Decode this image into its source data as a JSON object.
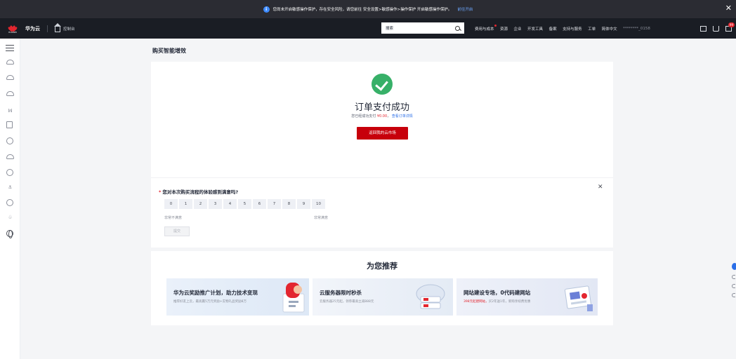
{
  "notice": {
    "text": "您尚未开启敏感操作保护，存在安全风险，请您前往 安全设置>敏感操作>操作保护 开启敏感操作保护。",
    "link": "前往开启"
  },
  "topnav": {
    "brand": "华为云",
    "logo_sub": "HUAWEI",
    "console": "控制台",
    "search_placeholder": "搜索",
    "links": [
      "费用与成本",
      "资源",
      "企业",
      "开发工具",
      "备案",
      "支持与服务",
      "工单",
      "简体中文"
    ],
    "username": "********_0158",
    "message_badge": "99"
  },
  "page": {
    "title": "购买智能增效"
  },
  "success": {
    "title": "订单支付成功",
    "sub_prefix": "您已经成功支付",
    "amount": "¥0.00",
    "sub_link": "查看订单详情",
    "button": "返回我的云市场"
  },
  "survey": {
    "required_mark": "*",
    "question": "您对本次购买流程的体验感到满意吗?",
    "scores": [
      "0",
      "1",
      "2",
      "3",
      "4",
      "5",
      "6",
      "7",
      "8",
      "9",
      "10"
    ],
    "low_label": "非常不满意",
    "high_label": "非常满意",
    "submit": "提交"
  },
  "recommend": {
    "title": "为您推荐",
    "banners": [
      {
        "title": "华为云奖励推广计划，助力技术变现",
        "sub": "推荐好友上云，最高赢5万元奖励+实物礼品奖励8万"
      },
      {
        "title": "云服务器限时秒杀",
        "sub": "云服务器25元起，领券最高立减888元"
      },
      {
        "title": "网站建设专场，0代码建网站",
        "sub_red": "398元起建网站，",
        "sub": "买2年送1年，新购享续费优惠"
      }
    ]
  },
  "colors": {
    "brand_red": "#c7000b",
    "success_green": "#37b068",
    "link_blue": "#2b6fe8"
  }
}
